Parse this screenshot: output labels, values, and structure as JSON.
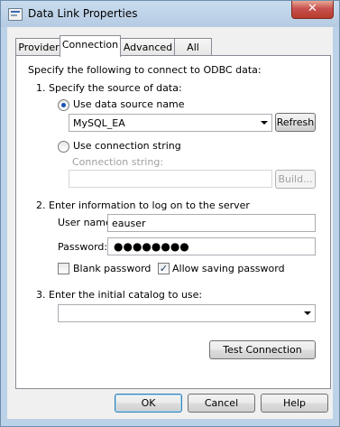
{
  "window": {
    "title": "Data Link Properties",
    "close_glyph": "✕"
  },
  "tabs": [
    {
      "label": "Provider"
    },
    {
      "label": "Connection"
    },
    {
      "label": "Advanced"
    },
    {
      "label": "All"
    }
  ],
  "connection": {
    "intro": "Specify the following to connect to ODBC data:",
    "step1": "1. Specify the source of data:",
    "use_dsn_label": "Use data source name",
    "dsn_value": "MySQL_EA",
    "refresh_label": "Refresh",
    "use_connstr_label": "Use connection string",
    "connstr_label": "Connection string:",
    "connstr_value": "",
    "build_label": "Build...",
    "step2": "2. Enter information to log on to the server",
    "username_label": "User name:",
    "username_value": "eauser",
    "password_label": "Password:",
    "password_value": "●●●●●●●●",
    "blank_password_label": "Blank password",
    "blank_password_checked": false,
    "allow_saving_label": "Allow saving password",
    "allow_saving_checked": true,
    "check_glyph": "✓",
    "step3": "3. Enter the initial catalog to use:",
    "catalog_value": "",
    "test_connection_label": "Test Connection"
  },
  "footer": {
    "ok_label": "OK",
    "cancel_label": "Cancel",
    "help_label": "Help"
  }
}
